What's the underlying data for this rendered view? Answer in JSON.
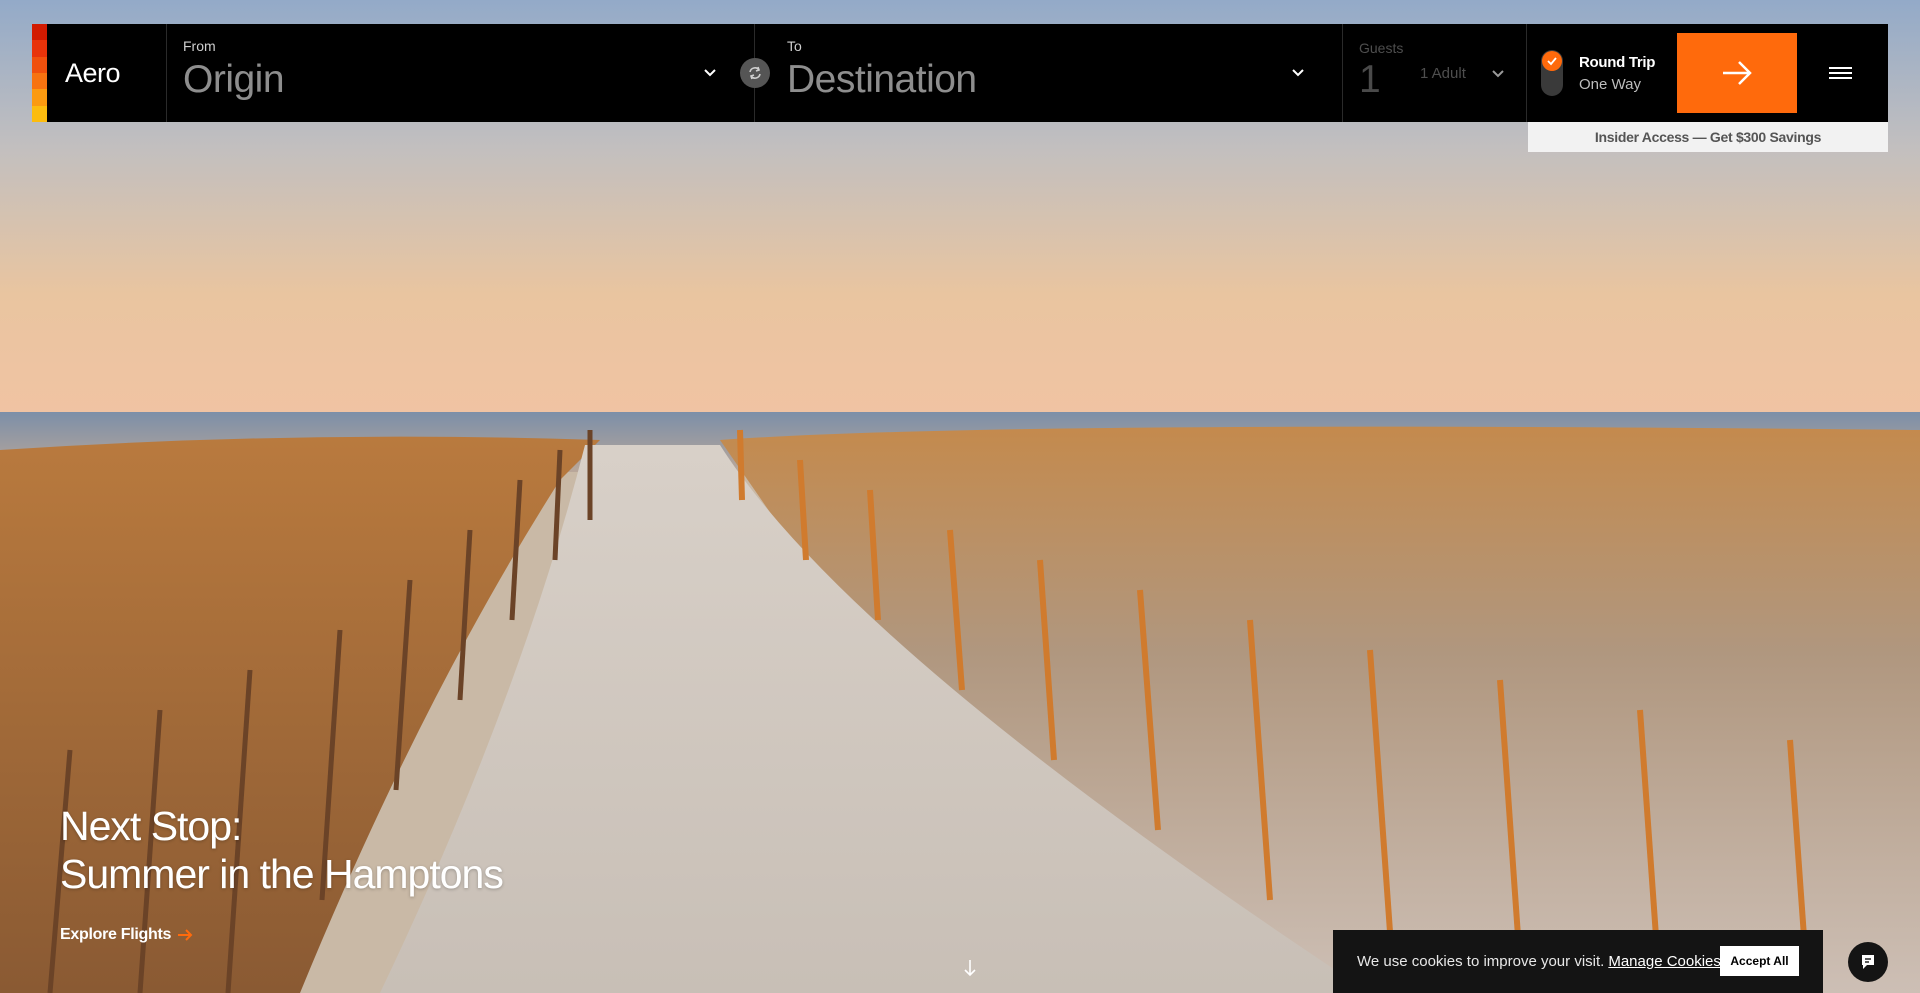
{
  "brand": {
    "name": "Aero",
    "stripe_colors": [
      "#d21a00",
      "#e8330a",
      "#f0500d",
      "#f77310",
      "#fb9a10",
      "#fcbc0f"
    ]
  },
  "search": {
    "from_label": "From",
    "from_value": "Origin",
    "to_label": "To",
    "to_value": "Destination",
    "guests_label": "Guests",
    "guests_count": "1",
    "guests_detail": "1 Adult",
    "trip_round": "Round Trip",
    "trip_oneway": "One Way",
    "trip_selected": "Round Trip"
  },
  "promo": {
    "text": "Insider Access — Get $300 Savings"
  },
  "hero": {
    "headline_line1": "Next Stop:",
    "headline_line2": "Summer in the Hamptons",
    "cta": "Explore Flights"
  },
  "cookie": {
    "message": "We use cookies to improve your visit.",
    "manage": "Manage Cookies",
    "accept": "Accept All"
  },
  "colors": {
    "accent": "#ff6a0c",
    "bar_bg": "#000000"
  },
  "icons": [
    "chevron-down-icon",
    "swap-icon",
    "check-icon",
    "arrow-right-icon",
    "menu-icon",
    "arrow-down-icon",
    "chat-icon"
  ]
}
